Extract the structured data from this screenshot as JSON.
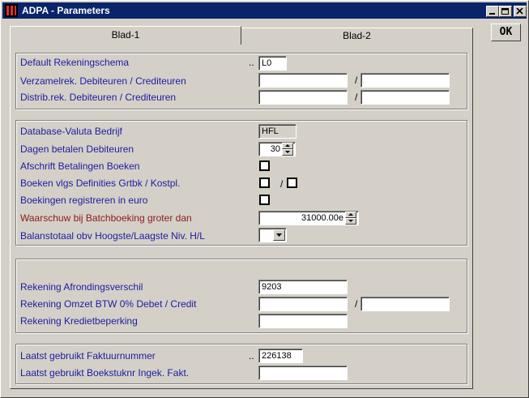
{
  "window": {
    "title": "ADPA - Parameters"
  },
  "ok_label": "OK",
  "tabs": [
    {
      "label": "Blad-1",
      "active": true
    },
    {
      "label": "Blad-2",
      "active": false
    }
  ],
  "group1": {
    "default_schema": {
      "label": "Default Rekeningschema",
      "dots": "..",
      "value": "L0"
    },
    "verzamel": {
      "label": "Verzamelrek. Debiteuren / Crediteuren",
      "value1": "",
      "value2": "",
      "sep": "/"
    },
    "distrib": {
      "label": "Distrib.rek. Debiteuren / Crediteuren",
      "value1": "",
      "value2": "",
      "sep": "/"
    }
  },
  "group2": {
    "valuta": {
      "label": "Database-Valuta Bedrijf",
      "value": "HFL"
    },
    "dagen": {
      "label": "Dagen betalen Debiteuren",
      "value": "30"
    },
    "afschrift": {
      "label": "Afschrift Betalingen Boeken",
      "checked": false
    },
    "boeken_vlgs": {
      "label": "Boeken vlgs Definities Grtbk / Kostpl.",
      "checked1": false,
      "checked2": false,
      "sep": "/"
    },
    "euro": {
      "label": "Boekingen registreren in euro",
      "checked": false
    },
    "waarschuw": {
      "label": "Waarschuw bij Batchboeking groter dan",
      "value": "31000.00e"
    },
    "balans": {
      "label": "Balanstotaal obv Hoogste/Laagste Niv. H/L",
      "value": ""
    }
  },
  "group3": {
    "afronding": {
      "label": "Rekening Afrondingsverschil",
      "value": "9203"
    },
    "omzet_btw": {
      "label": "Rekening Omzet BTW 0% Debet / Credit",
      "value1": "",
      "value2": "",
      "sep": "/"
    },
    "krediet": {
      "label": "Rekening Kredietbeperking",
      "value": ""
    }
  },
  "group4": {
    "faktuur": {
      "label": "Laatst gebruikt Faktuurnummer",
      "dots": "..",
      "value": "226138"
    },
    "boekstuk": {
      "label": "Laatst gebruikt Boekstuknr Ingek. Fakt.",
      "value": ""
    }
  },
  "colors": {
    "label": "#1c1ca0",
    "warning_label": "#8b1a1a",
    "titlebar": "#0a246a"
  }
}
